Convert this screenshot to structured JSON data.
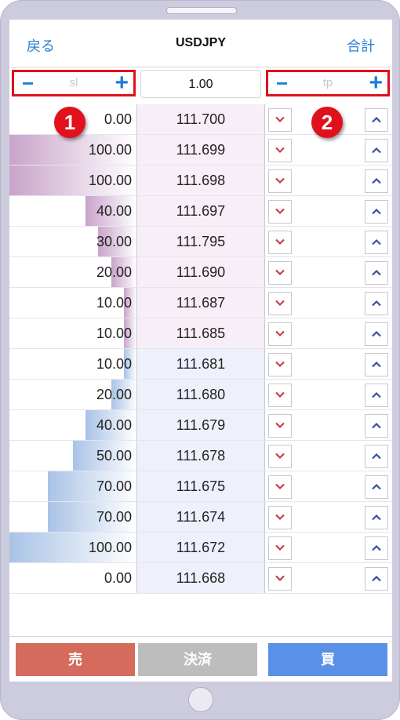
{
  "header": {
    "back_label": "戻る",
    "title": "USDJPY",
    "total_label": "合計"
  },
  "controls": {
    "sl_placeholder": "sl",
    "tp_placeholder": "tp",
    "minus": "−",
    "plus": "+",
    "quantity": "1.00"
  },
  "badges": [
    "1",
    "2"
  ],
  "rows": [
    {
      "volume": "0.00",
      "price": "111.700",
      "side": "ask"
    },
    {
      "volume": "100.00",
      "price": "111.699",
      "side": "ask"
    },
    {
      "volume": "100.00",
      "price": "111.698",
      "side": "ask"
    },
    {
      "volume": "40.00",
      "price": "111.697",
      "side": "ask"
    },
    {
      "volume": "30.00",
      "price": "111.795",
      "side": "ask"
    },
    {
      "volume": "20.00",
      "price": "111.690",
      "side": "ask"
    },
    {
      "volume": "10.00",
      "price": "111.687",
      "side": "ask"
    },
    {
      "volume": "10.00",
      "price": "111.685",
      "side": "ask"
    },
    {
      "volume": "10.00",
      "price": "111.681",
      "side": "bid"
    },
    {
      "volume": "20.00",
      "price": "111.680",
      "side": "bid"
    },
    {
      "volume": "40.00",
      "price": "111.679",
      "side": "bid"
    },
    {
      "volume": "50.00",
      "price": "111.678",
      "side": "bid"
    },
    {
      "volume": "70.00",
      "price": "111.675",
      "side": "bid"
    },
    {
      "volume": "70.00",
      "price": "111.674",
      "side": "bid"
    },
    {
      "volume": "100.00",
      "price": "111.672",
      "side": "bid"
    },
    {
      "volume": "0.00",
      "price": "111.668",
      "side": "bid"
    }
  ],
  "footer": {
    "sell_label": "売",
    "close_label": "決済",
    "buy_label": "買"
  },
  "colors": {
    "ask_bar": "#c9a3c9",
    "ask_price_bg": "#f8eef7",
    "bid_bar": "#a9c3e6",
    "bid_price_bg": "#eef1fc",
    "down_arrow": "#c0404a",
    "up_arrow": "#3b4f9a",
    "accent_red": "#e0101d",
    "link_blue": "#2e7fd6"
  },
  "icons": {
    "down": "chevron-down-icon",
    "up": "chevron-up-icon"
  }
}
